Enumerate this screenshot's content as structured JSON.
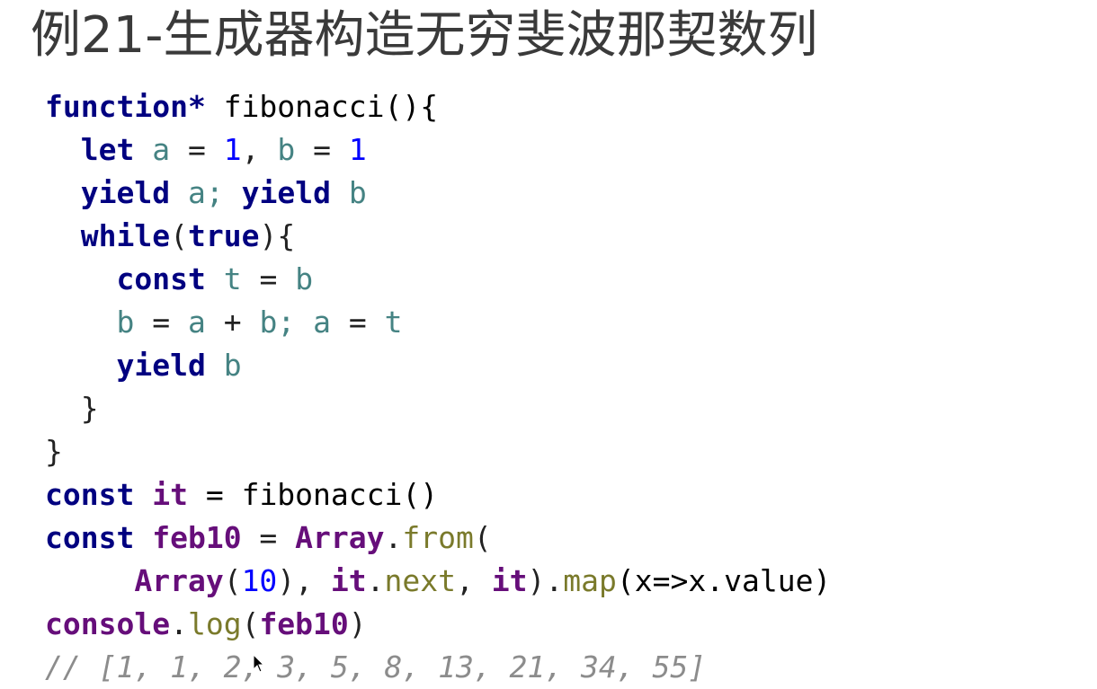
{
  "slide": {
    "title": "例21-生成器构造无穷斐波那契数列"
  },
  "code": {
    "lines": [
      [
        {
          "text": "function*",
          "cls": "kw"
        },
        {
          "text": " fibonacci(){",
          "cls": "fn"
        }
      ],
      [
        {
          "text": "  ",
          "cls": "punct"
        },
        {
          "text": "let",
          "cls": "kw"
        },
        {
          "text": " ",
          "cls": "punct"
        },
        {
          "text": "a",
          "cls": "var"
        },
        {
          "text": " = ",
          "cls": "punct"
        },
        {
          "text": "1",
          "cls": "num"
        },
        {
          "text": ", ",
          "cls": "punct"
        },
        {
          "text": "b",
          "cls": "var"
        },
        {
          "text": " = ",
          "cls": "punct"
        },
        {
          "text": "1",
          "cls": "num"
        }
      ],
      [
        {
          "text": "  ",
          "cls": "punct"
        },
        {
          "text": "yield",
          "cls": "kw"
        },
        {
          "text": " ",
          "cls": "punct"
        },
        {
          "text": "a;",
          "cls": "var"
        },
        {
          "text": " ",
          "cls": "punct"
        },
        {
          "text": "yield",
          "cls": "kw"
        },
        {
          "text": " ",
          "cls": "punct"
        },
        {
          "text": "b",
          "cls": "var"
        }
      ],
      [
        {
          "text": "  ",
          "cls": "punct"
        },
        {
          "text": "while",
          "cls": "kw"
        },
        {
          "text": "(",
          "cls": "punct"
        },
        {
          "text": "true",
          "cls": "kw"
        },
        {
          "text": "){",
          "cls": "punct"
        }
      ],
      [
        {
          "text": "    ",
          "cls": "punct"
        },
        {
          "text": "const",
          "cls": "kw"
        },
        {
          "text": " ",
          "cls": "punct"
        },
        {
          "text": "t",
          "cls": "var"
        },
        {
          "text": " = ",
          "cls": "punct"
        },
        {
          "text": "b",
          "cls": "var"
        }
      ],
      [
        {
          "text": "    ",
          "cls": "punct"
        },
        {
          "text": "b",
          "cls": "var"
        },
        {
          "text": " = ",
          "cls": "punct"
        },
        {
          "text": "a",
          "cls": "var"
        },
        {
          "text": " + ",
          "cls": "punct"
        },
        {
          "text": "b;",
          "cls": "var"
        },
        {
          "text": " ",
          "cls": "punct"
        },
        {
          "text": "a",
          "cls": "var"
        },
        {
          "text": " = ",
          "cls": "punct"
        },
        {
          "text": "t",
          "cls": "var"
        }
      ],
      [
        {
          "text": "    ",
          "cls": "punct"
        },
        {
          "text": "yield",
          "cls": "kw"
        },
        {
          "text": " ",
          "cls": "punct"
        },
        {
          "text": "b",
          "cls": "var"
        }
      ],
      [
        {
          "text": "  }",
          "cls": "punct"
        }
      ],
      [
        {
          "text": "}",
          "cls": "punct"
        }
      ],
      [
        {
          "text": "const",
          "cls": "kw"
        },
        {
          "text": " ",
          "cls": "punct"
        },
        {
          "text": "it",
          "cls": "obj"
        },
        {
          "text": " = fibonacci()",
          "cls": "fn"
        }
      ],
      [
        {
          "text": "const",
          "cls": "kw"
        },
        {
          "text": " ",
          "cls": "punct"
        },
        {
          "text": "feb10",
          "cls": "obj"
        },
        {
          "text": " = ",
          "cls": "punct"
        },
        {
          "text": "Array",
          "cls": "obj"
        },
        {
          "text": ".",
          "cls": "punct"
        },
        {
          "text": "from",
          "cls": "method"
        },
        {
          "text": "(",
          "cls": "punct"
        }
      ],
      [
        {
          "text": "     ",
          "cls": "punct"
        },
        {
          "text": "Array",
          "cls": "obj"
        },
        {
          "text": "(",
          "cls": "punct"
        },
        {
          "text": "10",
          "cls": "num"
        },
        {
          "text": "), ",
          "cls": "punct"
        },
        {
          "text": "it",
          "cls": "obj"
        },
        {
          "text": ".",
          "cls": "punct"
        },
        {
          "text": "next",
          "cls": "method"
        },
        {
          "text": ", ",
          "cls": "punct"
        },
        {
          "text": "it",
          "cls": "obj"
        },
        {
          "text": ").",
          "cls": "punct"
        },
        {
          "text": "map",
          "cls": "method"
        },
        {
          "text": "(x=>x.value)",
          "cls": "fn"
        }
      ],
      [
        {
          "text": "console",
          "cls": "obj"
        },
        {
          "text": ".",
          "cls": "punct"
        },
        {
          "text": "log",
          "cls": "method"
        },
        {
          "text": "(",
          "cls": "punct"
        },
        {
          "text": "feb10",
          "cls": "obj"
        },
        {
          "text": ")",
          "cls": "punct"
        }
      ],
      [
        {
          "text": "// [1, 1, 2, 3, 5, 8, 13, 21, 34, 55]",
          "cls": "comment"
        }
      ]
    ]
  },
  "colors": {
    "keyword": "#000080",
    "variable": "#458383",
    "number": "#0000ff",
    "method": "#7a7a2b",
    "object": "#660e7a",
    "comment": "#8c8c8c",
    "title": "#3a3a3a"
  },
  "icons": {
    "cursor": "mouse-pointer-icon"
  }
}
